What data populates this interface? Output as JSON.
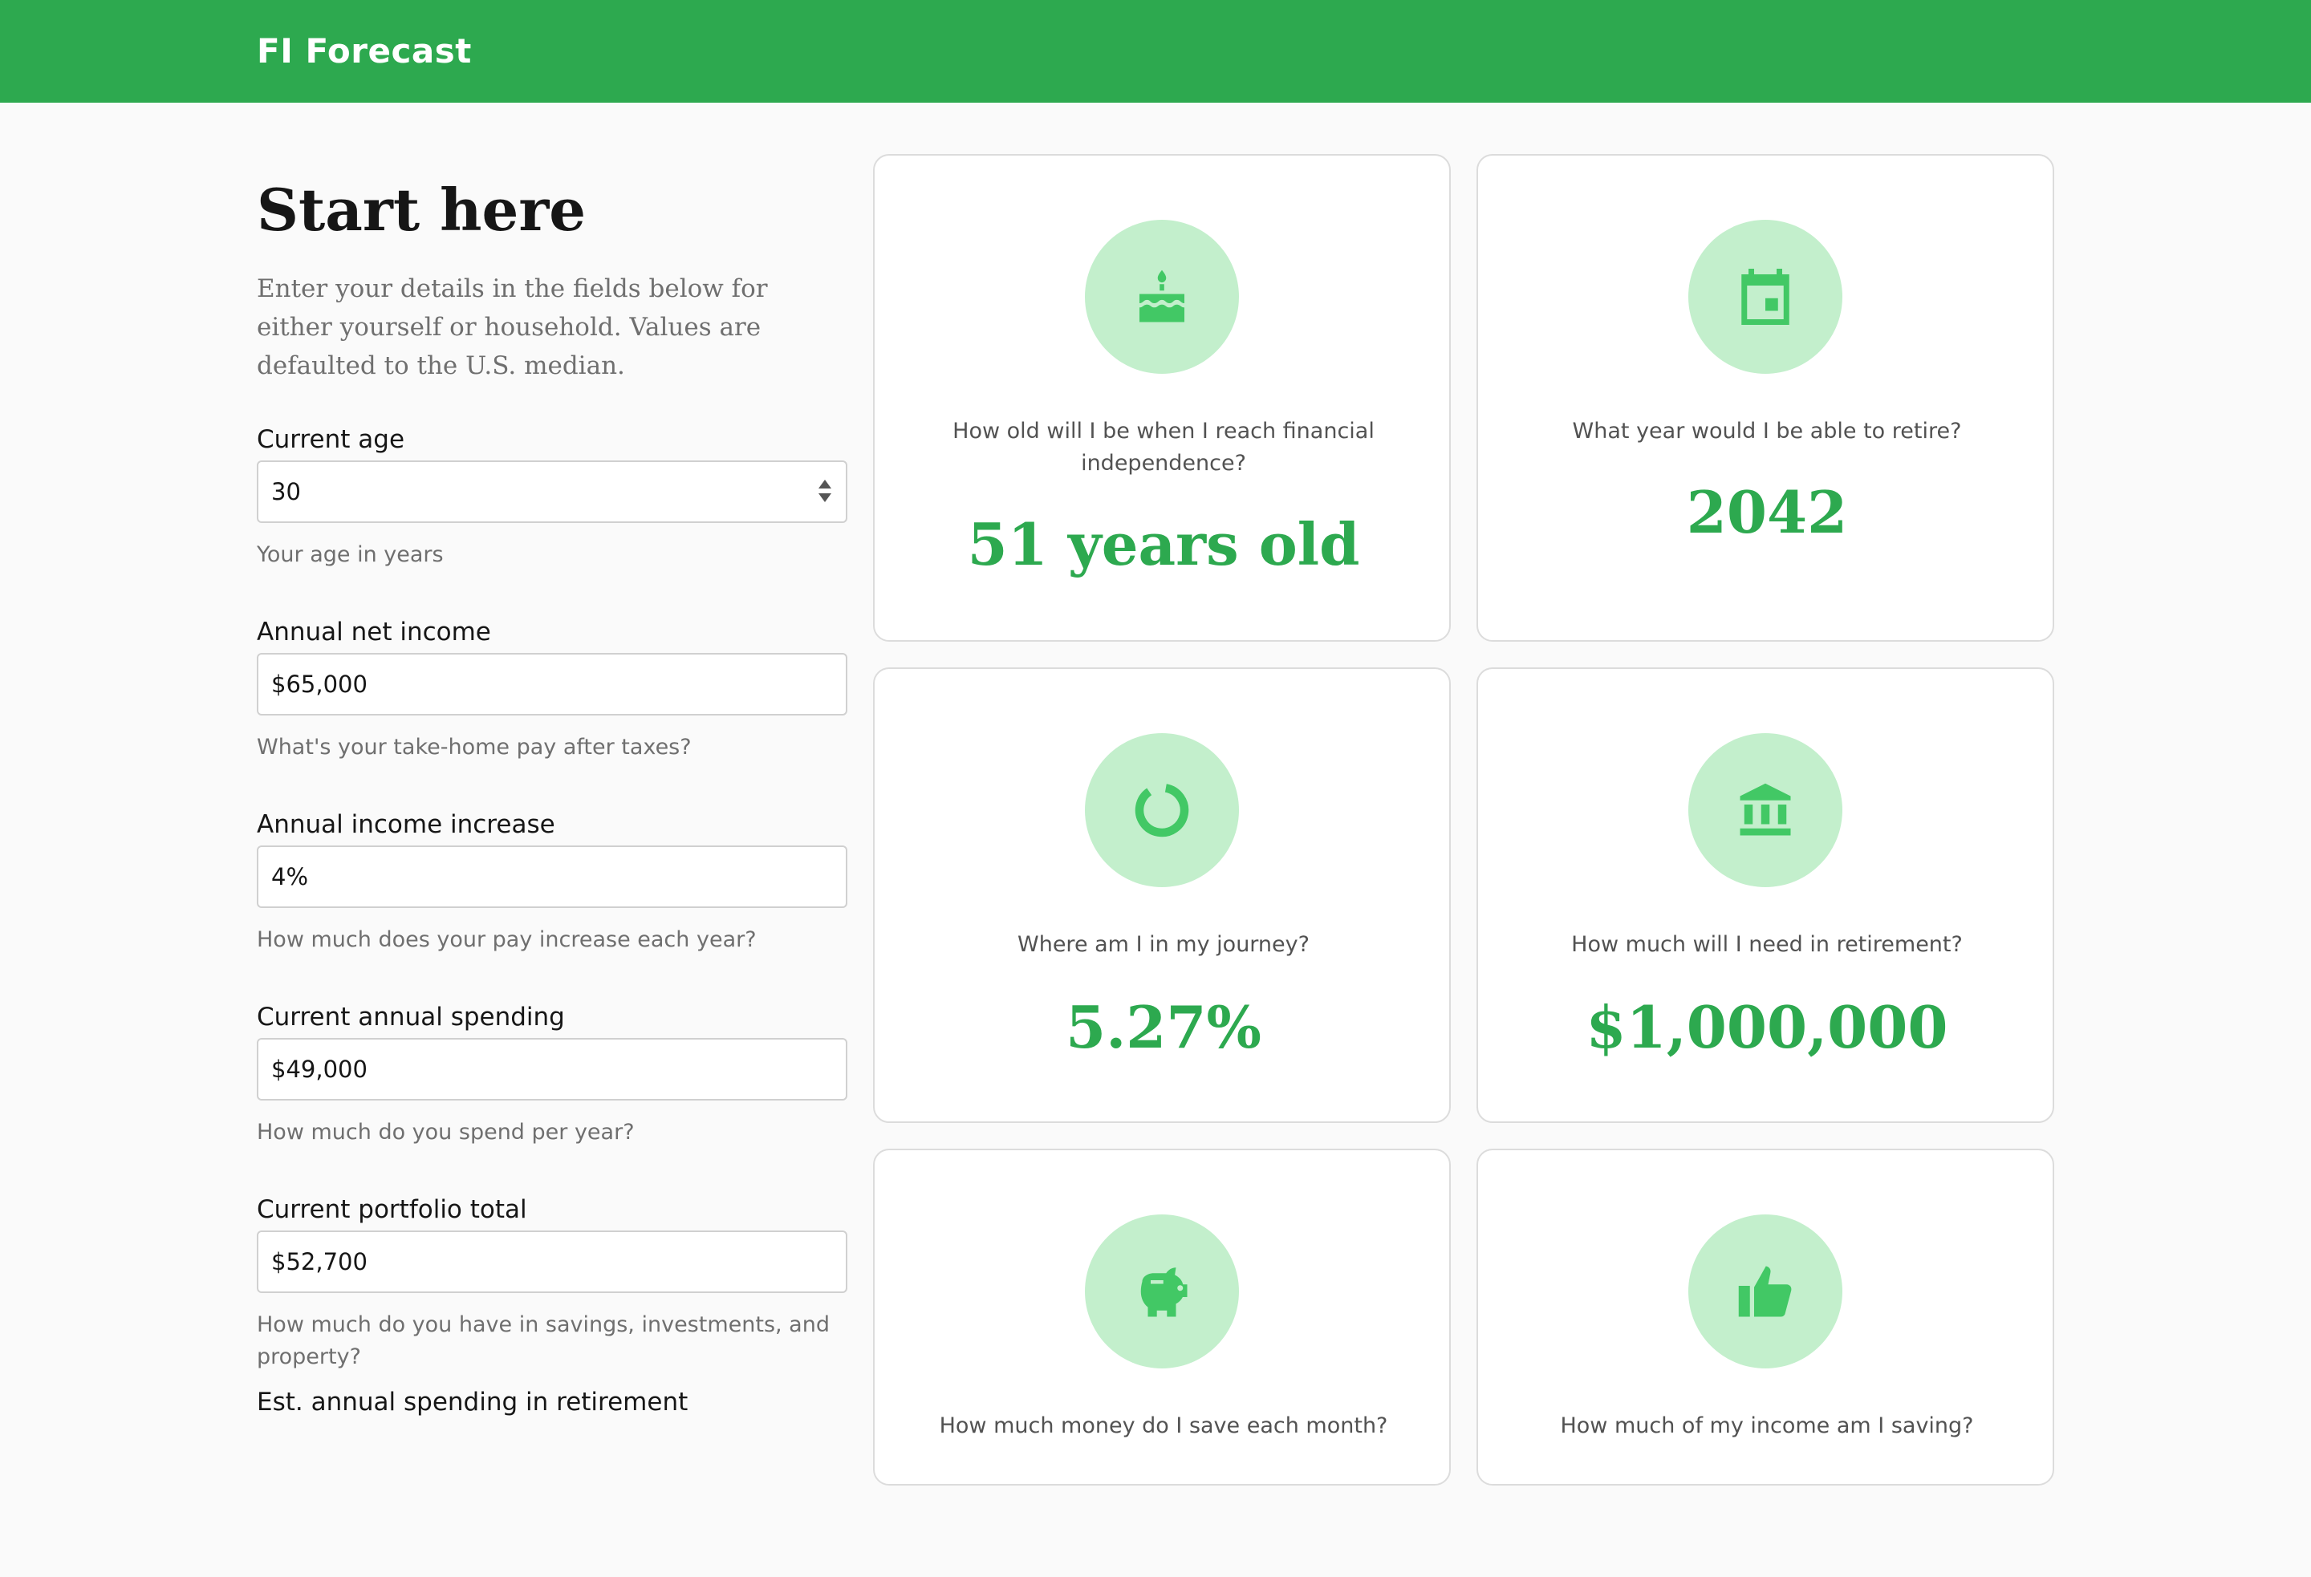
{
  "app": {
    "title": "FI Forecast"
  },
  "form": {
    "title": "Start here",
    "intro": "Enter your details in the fields below for either yourself or household. Values are defaulted to the U.S. median.",
    "fields": [
      {
        "label": "Current age",
        "value": "30",
        "help": "Your age in years"
      },
      {
        "label": "Annual net income",
        "value": "$65,000",
        "help": "What's your take-home pay after taxes?"
      },
      {
        "label": "Annual income increase",
        "value": "4%",
        "help": "How much does your pay increase each year?"
      },
      {
        "label": "Current annual spending",
        "value": "$49,000",
        "help": "How much do you spend per year?"
      },
      {
        "label": "Current portfolio total",
        "value": "$52,700",
        "help": "How much do you have in savings, investments, and property?"
      },
      {
        "label": "Est. annual spending in retirement"
      }
    ]
  },
  "cards": [
    {
      "icon": "cake-icon",
      "question": "How old will I be when I reach financial independence?",
      "answer": "51 years old"
    },
    {
      "icon": "calendar-icon",
      "question": "What year would I be able to retire?",
      "answer": "2042"
    },
    {
      "icon": "progress-ring-icon",
      "question": "Where am I in my journey?",
      "answer": "5.27%"
    },
    {
      "icon": "bank-icon",
      "question": "How much will I need in retirement?",
      "answer": "$1,000,000"
    },
    {
      "icon": "piggy-bank-icon",
      "question": "How much money do I save each month?"
    },
    {
      "icon": "thumbs-up-icon",
      "question": "How much of my income am I saving?"
    }
  ],
  "colors": {
    "brand": "#2da94f",
    "icon_bg": "#c3efcc",
    "icon_fg": "#42c865"
  }
}
